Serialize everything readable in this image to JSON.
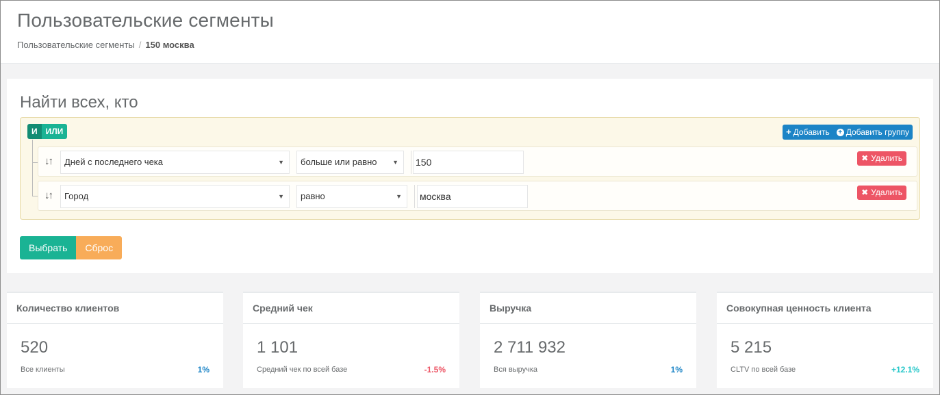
{
  "header": {
    "title": "Пользовательские сегменты",
    "breadcrumb_root": "Пользовательские сегменты",
    "breadcrumb_separator": "/",
    "breadcrumb_current": "150 москва"
  },
  "filter": {
    "title": "Найти всех, кто",
    "and_label": "И",
    "or_label": "ИЛИ",
    "add_label": "Добавить",
    "add_group_label": "Добавить группу",
    "rules": [
      {
        "field": "Дней с последнего чека",
        "operator": "больше или равно",
        "value": "150",
        "delete_label": "Удалить"
      },
      {
        "field": "Город",
        "operator": "равно",
        "value": "москва",
        "delete_label": "Удалить"
      }
    ],
    "submit_label": "Выбрать",
    "reset_label": "Сброс"
  },
  "stats": [
    {
      "title": "Количество клиентов",
      "value": "520",
      "caption": "Все клиенты",
      "delta": "1%",
      "delta_color": "#1c84c6"
    },
    {
      "title": "Средний чек",
      "value": "1 101",
      "caption": "Средний чек по всей базе",
      "delta": "-1.5%",
      "delta_color": "#ed5565"
    },
    {
      "title": "Выручка",
      "value": "2 711 932",
      "caption": "Вся выручка",
      "delta": "1%",
      "delta_color": "#1c84c6"
    },
    {
      "title": "Совокупная ценность клиента",
      "value": "5 215",
      "caption": "CLTV по всей базе",
      "delta": "+12.1%",
      "delta_color": "#23c6c8"
    }
  ],
  "colors": {
    "primary": "#1ab394",
    "success": "#1c84c6",
    "danger": "#ed5565",
    "warning": "#f8ac59",
    "info": "#23c6c8"
  },
  "icons": [
    "sort-icon",
    "plus-icon",
    "plus-circle-icon",
    "times-icon",
    "caret-down-icon"
  ]
}
